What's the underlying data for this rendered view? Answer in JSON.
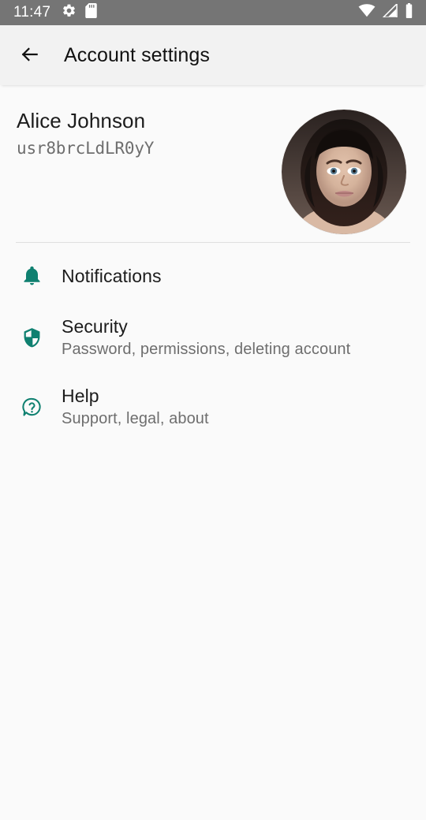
{
  "theme": {
    "accent": "#0f8070",
    "status_bar_bg": "#757575",
    "app_bar_bg": "#f2f2f2",
    "page_bg": "#fafafa",
    "title_color": "#1c1c1c",
    "subtitle_color": "#6e6e6e",
    "divider_color": "#e0e0e0"
  },
  "status_bar": {
    "clock": "11:47",
    "left_icons": [
      "gear-icon",
      "sd-card-icon"
    ],
    "right_icons": [
      "wifi-icon",
      "cellular-signal-icon",
      "battery-icon"
    ]
  },
  "app_bar": {
    "back_icon": "arrow-left-icon",
    "title": "Account settings"
  },
  "profile": {
    "name": "Alice Johnson",
    "user_id": "usr8brcLdLR0yY",
    "avatar": "user-avatar-photo"
  },
  "settings": {
    "items": [
      {
        "icon": "bell-icon",
        "title": "Notifications",
        "subtitle": ""
      },
      {
        "icon": "shield-icon",
        "title": "Security",
        "subtitle": "Password, permissions, deleting account"
      },
      {
        "icon": "help-bubble-icon",
        "title": "Help",
        "subtitle": "Support, legal, about"
      }
    ]
  }
}
